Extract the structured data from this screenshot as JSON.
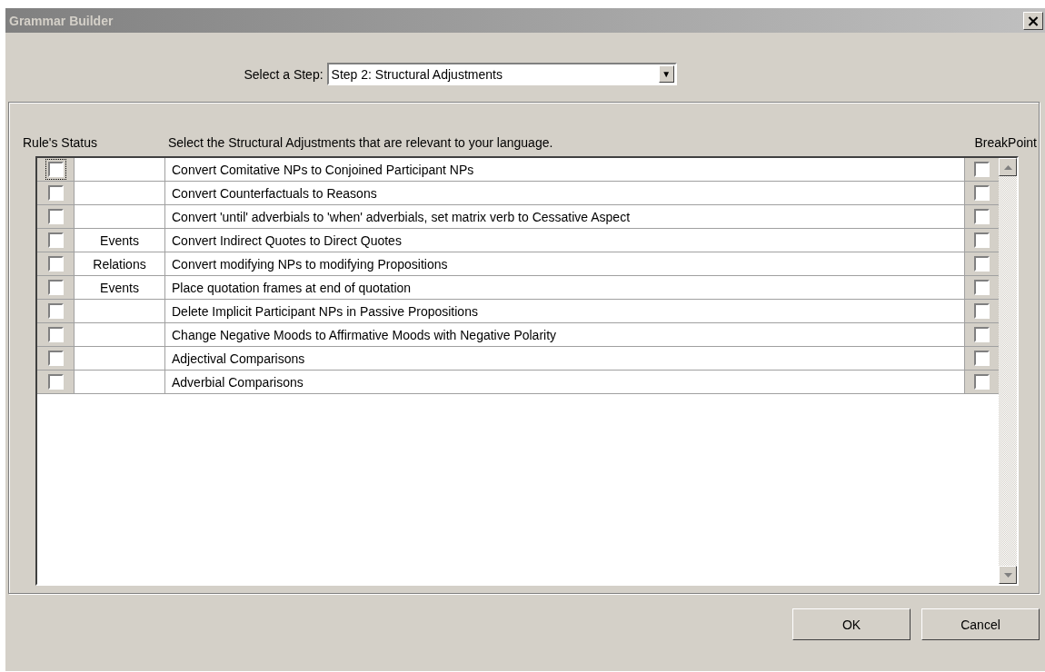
{
  "window": {
    "title": "Grammar Builder",
    "close": "×"
  },
  "step_select": {
    "label": "Select a Step:",
    "value": "Step 2: Structural Adjustments",
    "arrow": "▼"
  },
  "headers": {
    "status": "Rule's Status",
    "instruction": "Select the Structural Adjustments that are relevant to your language.",
    "breakpoint": "BreakPoint"
  },
  "rules": [
    {
      "checked": false,
      "focused": true,
      "name": "Convert Comitative NPs to Conjoined Participant NPs",
      "breakpoint": false
    },
    {
      "checked": false,
      "focused": false,
      "name": "Convert Counterfactuals to Reasons",
      "breakpoint": false
    },
    {
      "checked": false,
      "focused": false,
      "name": "Convert 'until' adverbials to 'when' adverbials, set matrix verb to Cessative Aspect",
      "breakpoint": false
    },
    {
      "checked": false,
      "focused": false,
      "status": "Events",
      "name": "Convert Indirect Quotes to Direct Quotes",
      "breakpoint": false
    },
    {
      "checked": false,
      "focused": false,
      "status": "Relations",
      "name": "Convert modifying NPs to modifying Propositions",
      "breakpoint": false
    },
    {
      "checked": false,
      "focused": false,
      "status": "Events",
      "name": "Place quotation frames at end of quotation",
      "breakpoint": false
    },
    {
      "checked": false,
      "focused": false,
      "name": "Delete Implicit Participant NPs in Passive Propositions",
      "breakpoint": false
    },
    {
      "checked": false,
      "focused": false,
      "name": "Change Negative Moods to Affirmative Moods with Negative Polarity",
      "breakpoint": false
    },
    {
      "checked": false,
      "focused": false,
      "name": "Adjectival Comparisons",
      "breakpoint": false
    },
    {
      "checked": false,
      "focused": false,
      "name": "Adverbial Comparisons",
      "breakpoint": false
    }
  ],
  "buttons": [
    "OK",
    "Cancel"
  ]
}
